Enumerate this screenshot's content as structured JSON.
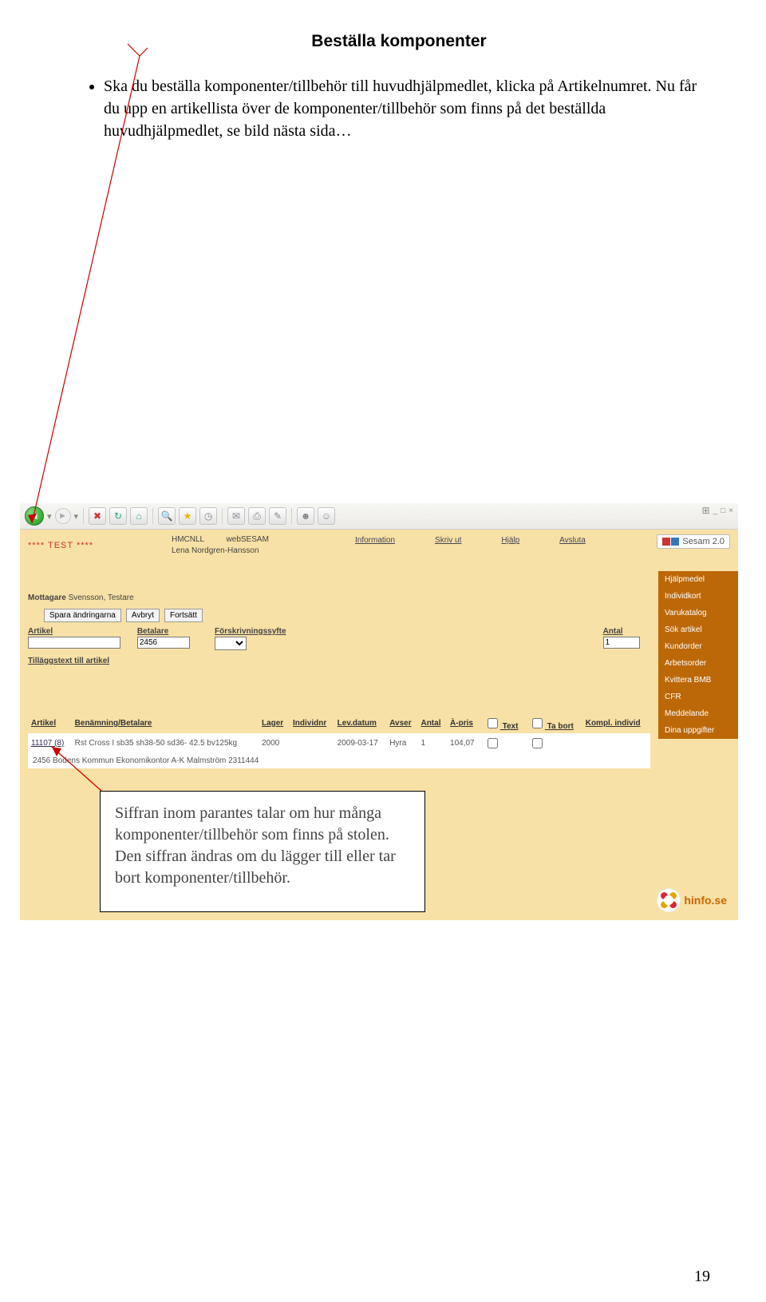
{
  "doc": {
    "title": "Beställa komponenter",
    "bullet": "Ska du beställa komponenter/tillbehör till huvudhjälpmedlet, klicka på Artikelnumret. Nu får du upp en artikellista över de komponenter/tillbehör som finns på det beställda huvudhjälpmedlet, se bild nästa sida…",
    "page_number": "19"
  },
  "callout": {
    "text": "Siffran inom parantes talar om hur många komponenter/tillbehör som finns på stolen. Den siffran ändras om du lägger till eller tar bort komponenter/tillbehör."
  },
  "app": {
    "test_label": "**** TEST ****",
    "unit": "HMCNLL",
    "system": "webSESAM",
    "user": "Lena Nordgren-Hansson",
    "nav": {
      "information": "Information",
      "skriv_ut": "Skriv ut",
      "hjalp": "Hjälp",
      "avsluta": "Avsluta"
    },
    "sesam_label": "Sesam 2.0",
    "win_close": "×"
  },
  "sidebar": [
    "Hjälpmedel",
    "Individkort",
    "Varukatalog",
    "Sök artikel",
    "Kundorder",
    "Arbetsorder",
    "Kvittera BMB",
    "CFR",
    "Meddelande",
    "Dina uppgifter"
  ],
  "form": {
    "mottagare_label": "Mottagare",
    "mottagare_value": "Svensson, Testare",
    "btn_save": "Spara ändringarna",
    "btn_cancel": "Avbryt",
    "btn_continue": "Fortsätt",
    "artikel_label": "Artikel",
    "artikel_value": "",
    "betalare_label": "Betalare",
    "betalare_value": "2456",
    "forskrivning_label": "Förskrivningssyfte",
    "antal_label": "Antal",
    "antal_value": "1",
    "tillagg_label": "Tilläggstext till artikel"
  },
  "table": {
    "headers": {
      "artikel": "Artikel",
      "benamning": "Benämning/Betalare",
      "lager": "Lager",
      "individnr": "Individnr",
      "levdatum": "Lev.datum",
      "avser": "Avser",
      "antal": "Antal",
      "apris": "À-pris",
      "text": "Text",
      "tabort": "Ta bort",
      "kompl": "Kompl. individ"
    },
    "row": {
      "artikel": "11107 (8)",
      "benamning": "Rst Cross I sb35 sh38-50 sd36- 42.5 bv125kg",
      "lager": "2000",
      "individnr": "",
      "levdatum": "2009-03-17",
      "avser": "Hyra",
      "antal": "1",
      "apris": "104,07"
    },
    "payer_row": "2456 Bodens Kommun Ekonomikontor A-K Malmström 2311444"
  },
  "hinfo": "hinfo.se"
}
